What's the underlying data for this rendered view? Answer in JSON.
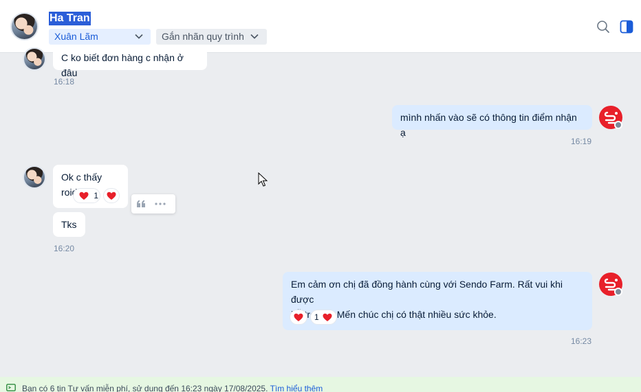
{
  "header": {
    "contact_name": "Ha Tran",
    "assignee": "Xuân Lãm",
    "tag_placeholder": "Gắn nhãn quy trình"
  },
  "messages": [
    {
      "direction": "in",
      "text": "C ko biết đơn hàng c nhận ở đâu",
      "time": "16:18"
    },
    {
      "direction": "out",
      "text": "mình nhấn vào sẽ có thông tin điểm nhận ạ",
      "time": "16:19"
    },
    {
      "direction": "in",
      "text": "Ok c thấy roid",
      "reaction_count": "1"
    },
    {
      "direction": "in",
      "text": "Tks",
      "time": "16:20"
    },
    {
      "direction": "out",
      "line1": "Em cảm ơn chị đã đồng hành cùng với Sendo Farm. Rất vui khi được",
      "line2": "hỗ trợ chị. Mến chúc chị có thật nhiều sức khỏe.",
      "reaction_count": "1",
      "time": "16:23"
    }
  ],
  "footer": {
    "text": "Bạn có 6 tin Tư vấn miễn phí, sử dụng đến 16:23 ngày 17/08/2025.",
    "link": "Tìm hiểu thêm"
  },
  "colors": {
    "accent": "#1a5cd8",
    "outgoing_bubble": "#dbebff",
    "incoming_bubble": "#ffffff",
    "background": "#ebedf0",
    "sendo_red": "#e8202a",
    "footer_bg": "#e6f7e2"
  },
  "icons": [
    "search-icon",
    "side-panel-icon",
    "chevron-down-icon",
    "quote-icon",
    "more-icon",
    "heart-icon",
    "message-icon"
  ]
}
